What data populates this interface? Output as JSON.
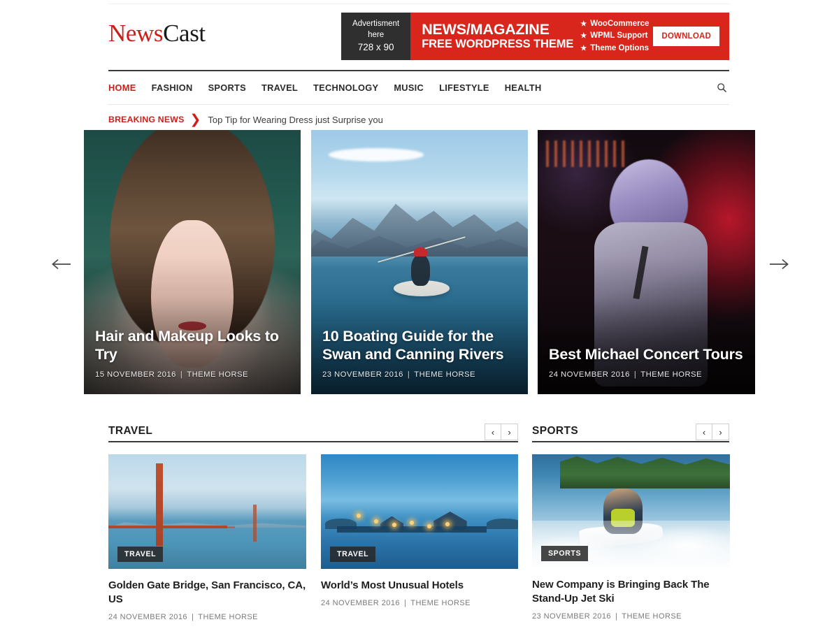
{
  "site": {
    "logo_primary": "News",
    "logo_secondary": "Cast"
  },
  "ad": {
    "label_line1": "Advertisment",
    "label_line2": "here",
    "size": "728 x 90",
    "title": "NEWS/MAGAZINE",
    "subtitle": "FREE WORDPRESS THEME",
    "features": [
      "WooCommerce",
      "WPML Support",
      "Theme Options"
    ],
    "star": "★",
    "button": "DOWNLOAD"
  },
  "nav": {
    "items": [
      {
        "label": "HOME",
        "active": true
      },
      {
        "label": "FASHION",
        "active": false
      },
      {
        "label": "SPORTS",
        "active": false
      },
      {
        "label": "TRAVEL",
        "active": false
      },
      {
        "label": "TECHNOLOGY",
        "active": false
      },
      {
        "label": "MUSIC",
        "active": false
      },
      {
        "label": "LIFESTYLE",
        "active": false
      },
      {
        "label": "HEALTH",
        "active": false
      }
    ],
    "search_icon": "search-icon"
  },
  "breaking": {
    "label": "BREAKING NEWS",
    "chevron": "❯",
    "headline": "Top Tip for Wearing Dress just Surprise you"
  },
  "slider": {
    "prev_arrow": "←",
    "next_arrow": "→",
    "slides": [
      {
        "title": "Hair and Makeup Looks to Try",
        "date": "15 NOVEMBER 2016",
        "author": "THEME HORSE",
        "separator": "|"
      },
      {
        "title": "10 Boating Guide for the Swan and Canning Rivers",
        "date": "23 NOVEMBER 2016",
        "author": "THEME HORSE",
        "separator": "|"
      },
      {
        "title": "Best Michael Concert Tours",
        "date": "24 NOVEMBER 2016",
        "author": "THEME HORSE",
        "separator": "|"
      }
    ]
  },
  "sections": [
    {
      "title": "TRAVEL",
      "prev": "‹",
      "next": "›"
    },
    {
      "title": "SPORTS",
      "prev": "‹",
      "next": "›"
    }
  ],
  "cards": [
    {
      "category": "TRAVEL",
      "title": "Golden Gate Bridge, San Francisco, CA, US",
      "date": "24 NOVEMBER 2016",
      "author": "THEME HORSE",
      "separator": "|"
    },
    {
      "category": "TRAVEL",
      "title": "World’s Most Unusual Hotels",
      "date": "24 NOVEMBER 2016",
      "author": "THEME HORSE",
      "separator": "|"
    },
    {
      "category": "SPORTS",
      "title": "New Company is Bringing Back The Stand-Up Jet Ski",
      "date": "23 NOVEMBER 2016",
      "author": "THEME HORSE",
      "separator": "|"
    }
  ],
  "colors": {
    "brand_red": "#cc1f1a",
    "ad_red": "#d9261c",
    "ad_dark": "#2f2f2f",
    "text_dark": "#1f1f1f",
    "meta_gray": "#7a7a7a"
  }
}
